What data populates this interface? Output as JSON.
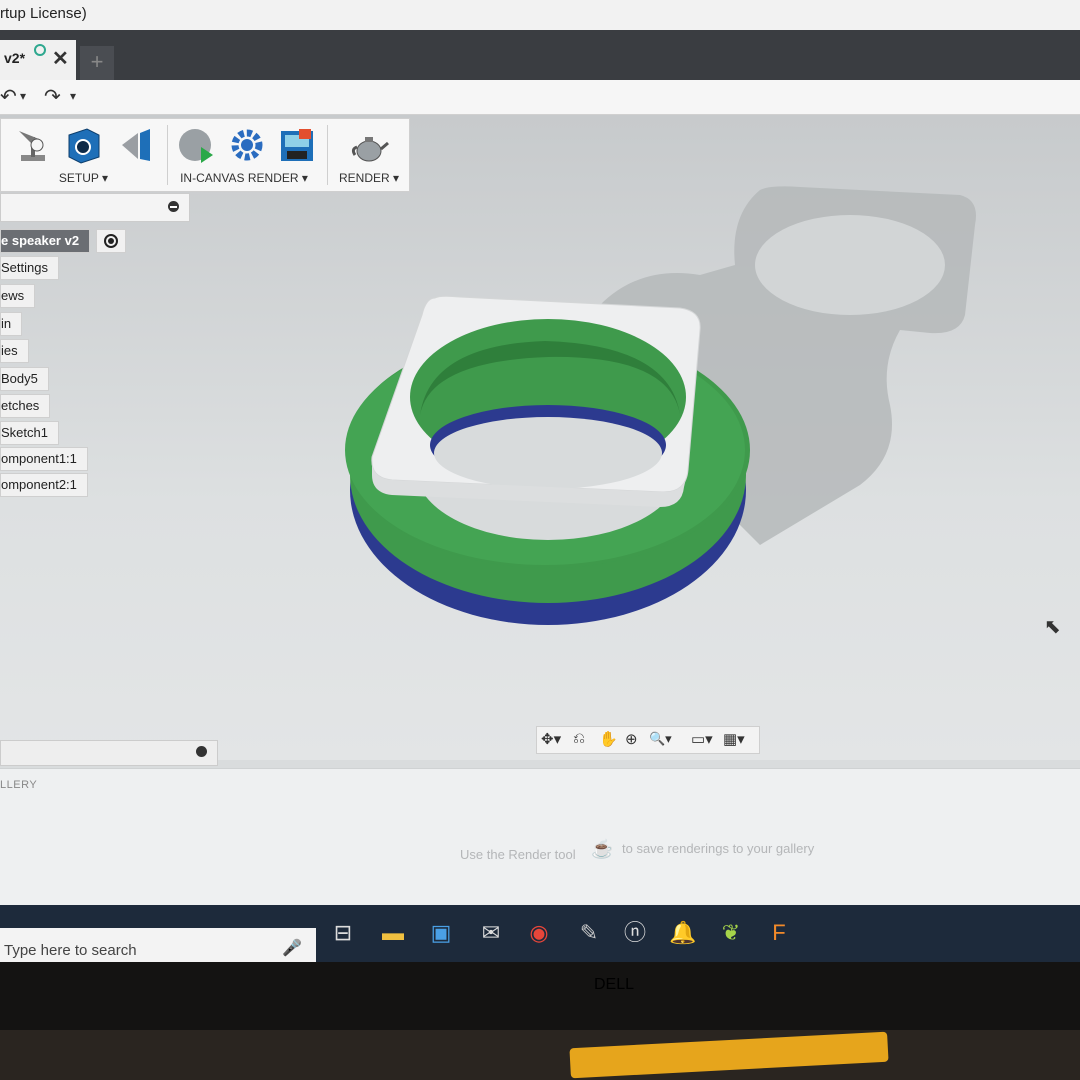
{
  "window": {
    "title": "rtup License)"
  },
  "tab": {
    "label": "v2*",
    "close": "✕",
    "new_tab": "+"
  },
  "quick_access": {
    "undo": "↶",
    "undo_caret": "▾",
    "redo": "↷",
    "redo_caret": "▾"
  },
  "toolbar": {
    "groups": [
      {
        "label": "SETUP ▾"
      },
      {
        "label": "IN-CANVAS RENDER ▾"
      },
      {
        "label": "RENDER ▾"
      }
    ]
  },
  "browser": {
    "items": [
      {
        "label": "e speaker v2"
      },
      {
        "label": "Settings"
      },
      {
        "label": "ews"
      },
      {
        "label": "in"
      },
      {
        "label": "ies"
      },
      {
        "label": "Body5"
      },
      {
        "label": "etches"
      },
      {
        "label": "Sketch1"
      },
      {
        "label": "omponent1:1"
      },
      {
        "label": "omponent2:1"
      }
    ]
  },
  "navbar": {
    "icons": [
      "✥▾",
      "⎌",
      "✋",
      "⊕",
      "🔍▾",
      "▭▾",
      "▦▾"
    ]
  },
  "gallery": {
    "title": "LLERY",
    "message_left": "Use the Render tool",
    "message_right": "to save renderings to your gallery"
  },
  "taskbar": {
    "search_placeholder": "Type here to search",
    "mic": "🎤"
  },
  "monitor": {
    "brand": "DELL"
  },
  "colors": {
    "ring": "#3f9a4c",
    "base": "#2c3a8f",
    "bracket": "#eeeff0",
    "toolbar_bg": "#f7f7f7"
  }
}
